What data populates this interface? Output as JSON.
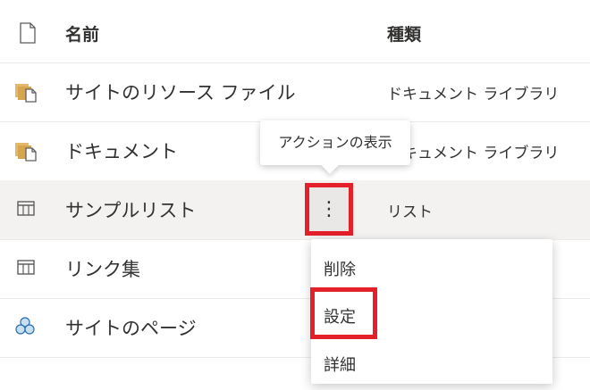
{
  "header": {
    "name_label": "名前",
    "type_label": "種類",
    "icon": "document-icon"
  },
  "rows": [
    {
      "name": "サイトのリソース ファイル",
      "type": "ドキュメント ライブラリ",
      "icon": "library-icon"
    },
    {
      "name": "ドキュメント",
      "type": "ドキュメント ライブラリ",
      "icon": "library-icon"
    },
    {
      "name": "サンプルリスト",
      "type": "リスト",
      "icon": "list-icon",
      "selected": true
    },
    {
      "name": "リンク集",
      "type": "",
      "icon": "list-icon"
    },
    {
      "name": "サイトのページ",
      "type": "",
      "icon": "site-pages-icon"
    }
  ],
  "more_actions": {
    "glyph": "⋮"
  },
  "tooltip": {
    "text": "アクションの表示"
  },
  "context_menu": {
    "items": [
      {
        "label": "削除"
      },
      {
        "label": "設定",
        "highlighted": true
      },
      {
        "label": "詳細"
      }
    ]
  },
  "colors": {
    "highlight_border": "#e4202a",
    "selected_row": "#f3f2f1",
    "library_icon": "#d8a54f"
  }
}
